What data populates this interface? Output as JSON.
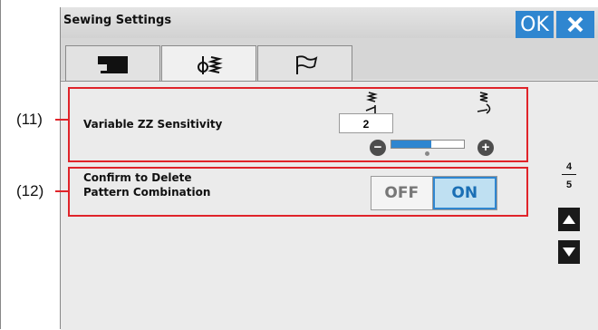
{
  "title": "Sewing Settings",
  "ok_label": "OK",
  "tabs": [
    {
      "name": "machine-icon"
    },
    {
      "name": "stitch-icon"
    },
    {
      "name": "flag-icon"
    }
  ],
  "settings": {
    "zz_label": "Variable ZZ Sensitivity",
    "zz_value": "2",
    "zz_slider_level": 0.55,
    "confirm_label_line1": "Confirm to Delete",
    "confirm_label_line2": "Pattern Combination",
    "toggle_off": "OFF",
    "toggle_on": "ON",
    "toggle_selected": "ON"
  },
  "pager": {
    "current": "4",
    "total": "5"
  },
  "callouts": {
    "c11": "(11)",
    "c12": "(12)"
  },
  "colors": {
    "accent": "#2f86d0",
    "callout": "#e0242a"
  }
}
